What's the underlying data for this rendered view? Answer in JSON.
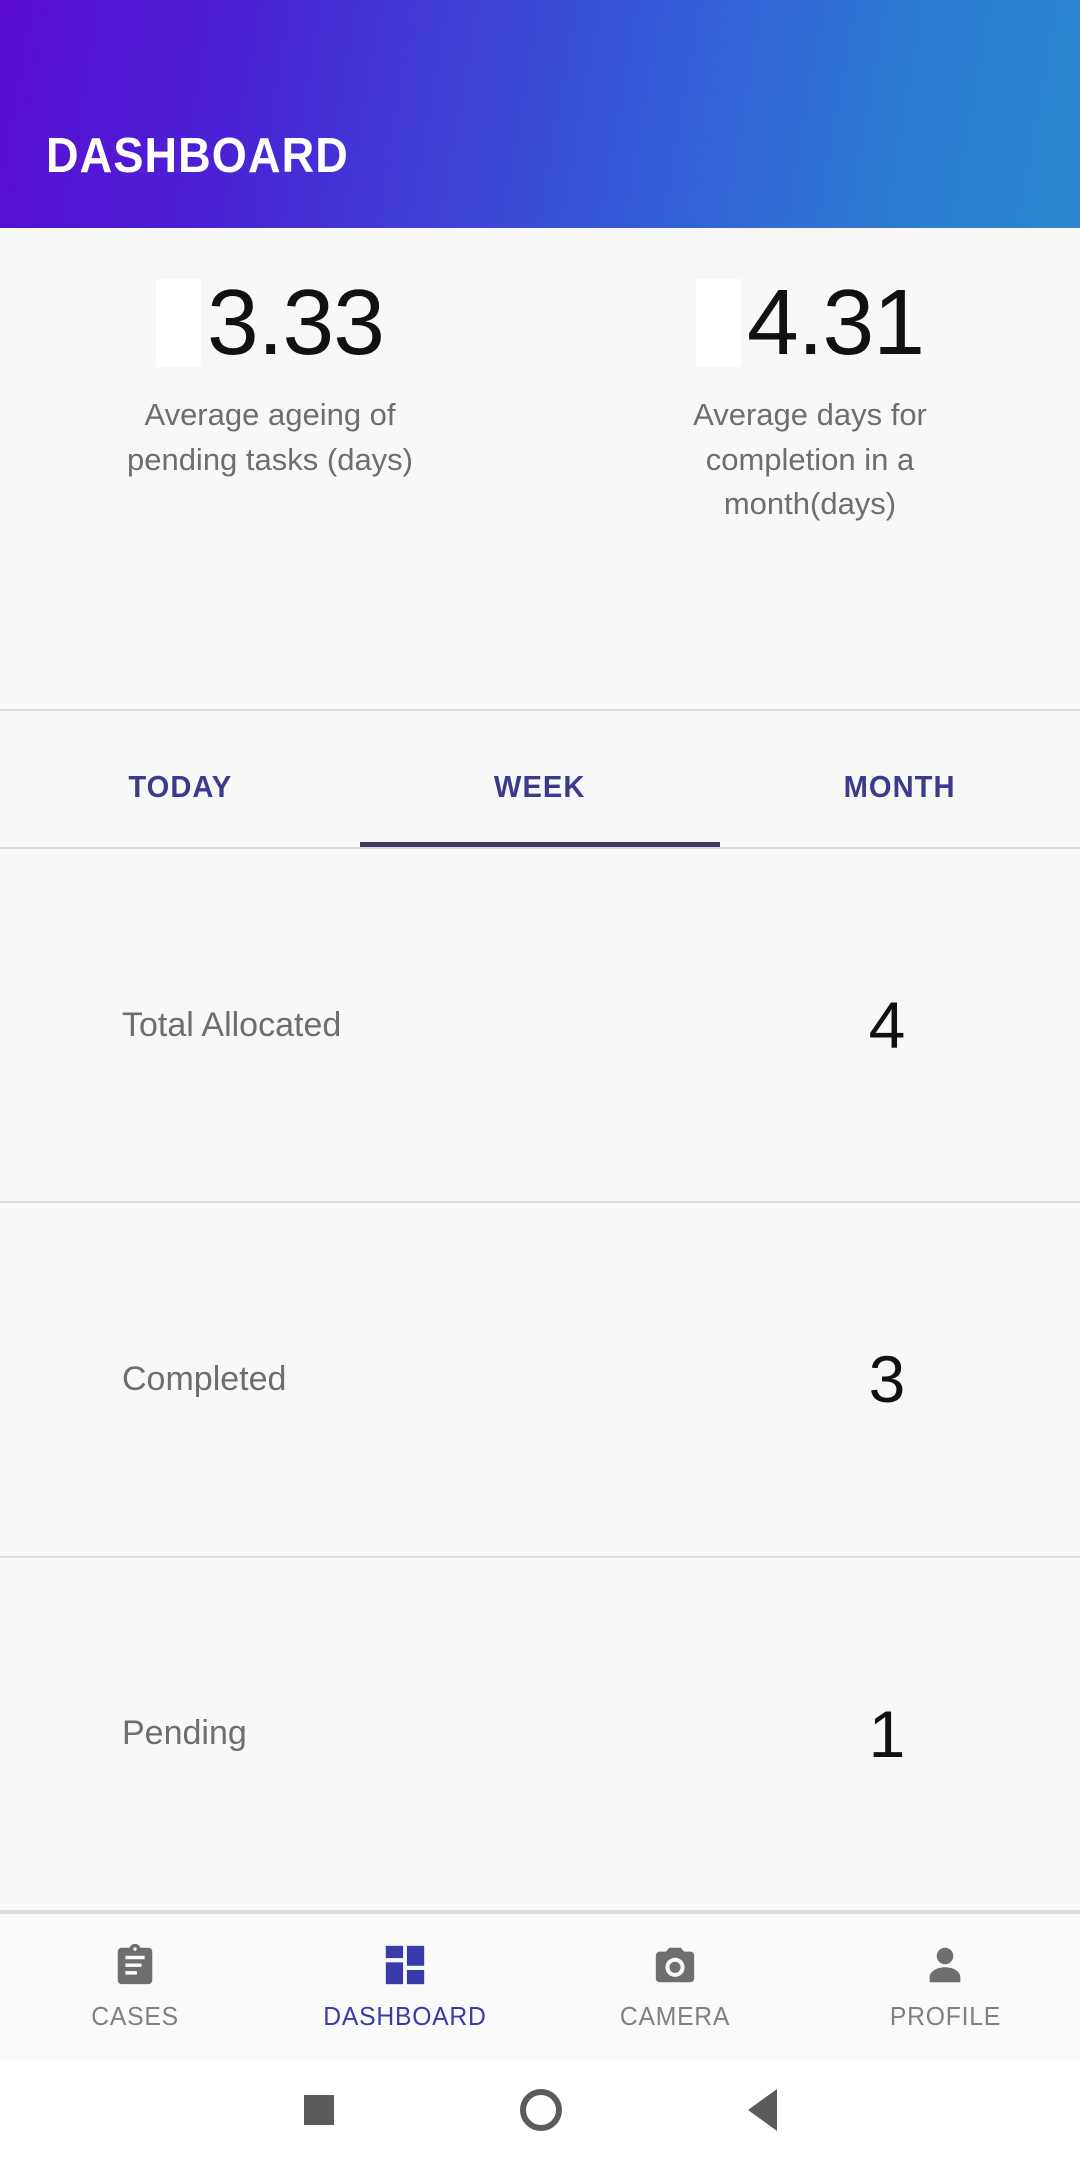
{
  "appbar": {
    "title": "DASHBOARD"
  },
  "colors": {
    "gradient_start": "#5a0cd2",
    "gradient_end": "#2b86d1",
    "accent_indigo": "#3b3a8c",
    "nav_active": "#3a3bab",
    "muted_text": "#6e6e6e",
    "divider": "#dcdcdc",
    "page_bg": "#f8f8f8"
  },
  "stats": [
    {
      "value": "3.33",
      "label": "Average ageing of pending tasks (days)",
      "image_placeholder": "broken-image-placeholder"
    },
    {
      "value": "4.31",
      "label": "Average days for completion in a month(days)",
      "image_placeholder": "broken-image-placeholder"
    }
  ],
  "tabs": [
    {
      "label": "TODAY",
      "active": false
    },
    {
      "label": "WEEK",
      "active": true
    },
    {
      "label": "MONTH",
      "active": false
    }
  ],
  "rows": [
    {
      "label": "Total Allocated",
      "value": "4"
    },
    {
      "label": "Completed",
      "value": "3"
    },
    {
      "label": "Pending",
      "value": "1"
    }
  ],
  "bottom_nav": [
    {
      "label": "CASES",
      "icon": "clipboard-icon",
      "active": false
    },
    {
      "label": "DASHBOARD",
      "icon": "grid-dashboard-icon",
      "active": true
    },
    {
      "label": "CAMERA",
      "icon": "camera-icon",
      "active": false
    },
    {
      "label": "PROFILE",
      "icon": "person-icon",
      "active": false
    }
  ],
  "system_bar": [
    {
      "icon": "recent-apps-square-icon"
    },
    {
      "icon": "home-circle-icon"
    },
    {
      "icon": "back-triangle-icon"
    }
  ]
}
